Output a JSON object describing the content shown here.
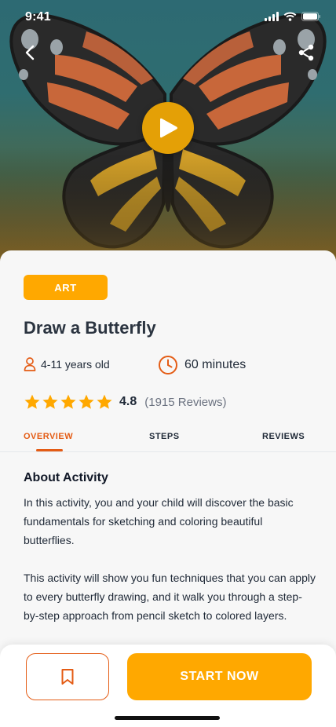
{
  "status_bar": {
    "time": "9:41"
  },
  "hero": {
    "back_icon": "chevron-left-icon",
    "share_icon": "share-icon",
    "play_icon": "play-icon",
    "colors": {
      "play_button": "#e4a006",
      "wing_orange": "#c8673a",
      "wing_yellow": "#d9a52a"
    }
  },
  "activity": {
    "tag": "ART",
    "title": "Draw a Butterfly",
    "age": "4-11 years old",
    "duration": "60 minutes",
    "rating": {
      "stars": 5,
      "score": "4.8",
      "reviews": "(1915 Reviews)"
    }
  },
  "tabs": [
    {
      "label": "OVERVIEW",
      "active": true
    },
    {
      "label": "STEPS",
      "active": false
    },
    {
      "label": "REVIEWS",
      "active": false
    }
  ],
  "about": {
    "heading": "About Activity",
    "paragraph_1": "In this activity, you and your child will discover the basic fundamentals for sketching and coloring beautiful butterflies.",
    "paragraph_2": "This activity will show you fun techniques that you can apply to every butterfly drawing, and it walk you through a step-by-step approach from pencil sketch to colored layers."
  },
  "bottom_bar": {
    "bookmark_icon": "bookmark-icon",
    "start_label": "START NOW"
  },
  "colors": {
    "accent": "#ffa800",
    "accent_dark": "#e45c15",
    "star": "#ffa800"
  }
}
